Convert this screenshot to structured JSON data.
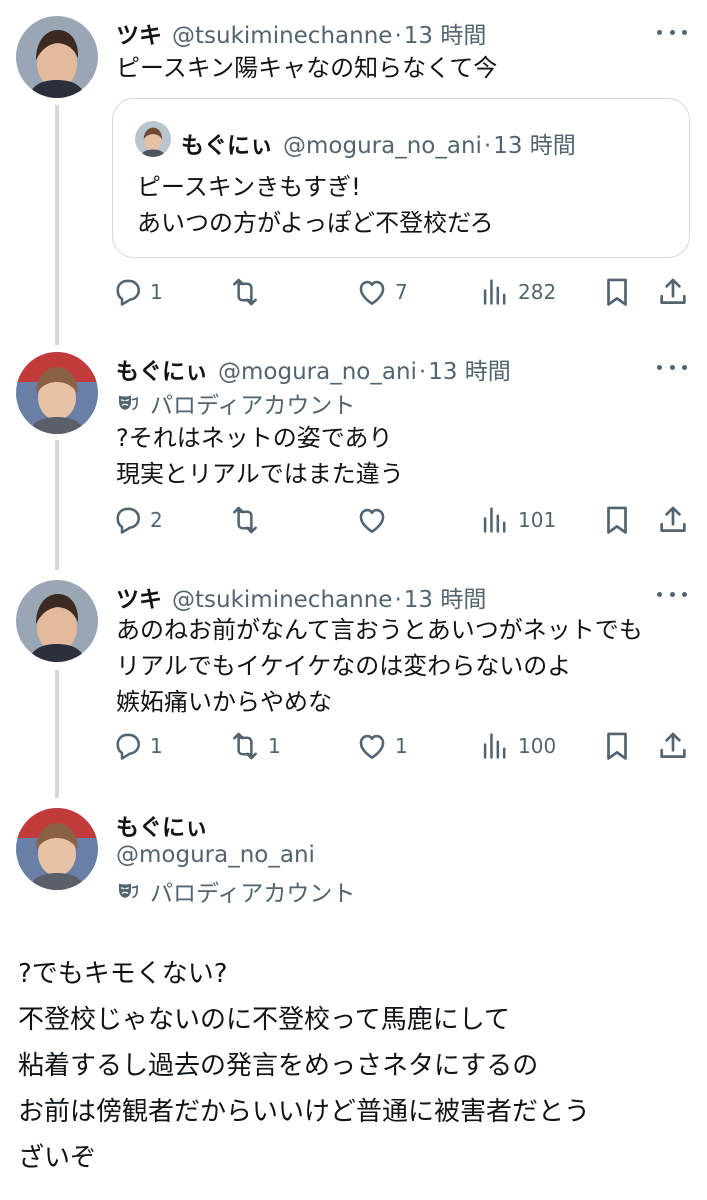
{
  "tweets": [
    {
      "name": "ツキ",
      "handle": "@tsukiminechanne",
      "time": "13 時間",
      "text": "ピースキン陽キャなの知らなくて今",
      "quote": {
        "name": "もぐにぃ",
        "handle": "@mogura_no_ani",
        "time": "13 時間",
        "text": "ピースキンきもすぎ!\nあいつの方がよっぽど不登校だろ"
      },
      "replies": "1",
      "reposts": "",
      "likes": "7",
      "views": "282"
    },
    {
      "name": "もぐにぃ",
      "handle": "@mogura_no_ani",
      "time": "13 時間",
      "label": "パロディアカウント",
      "text": "?それはネットの姿であり\n現実とリアルではまた違う",
      "replies": "2",
      "reposts": "",
      "likes": "",
      "views": "101"
    },
    {
      "name": "ツキ",
      "handle": "@tsukiminechanne",
      "time": "13 時間",
      "text": "あのねお前がなんて言おうとあいつがネットでも\nリアルでもイケイケなのは変わらないのよ\n嫉妬痛いからやめな",
      "replies": "1",
      "reposts": "1",
      "likes": "1",
      "views": "100"
    }
  ],
  "main": {
    "name": "もぐにぃ",
    "handle": "@mogura_no_ani",
    "label": "パロディアカウント",
    "text": "?でもキモくない?\n不登校じゃないのに不登校って馬鹿にして\n粘着するし過去の発言をめっさネタにするの\nお前は傍観者だからいいけど普通に被害者だとう\nざいぞ"
  },
  "colors": {
    "text": "#0f1419",
    "secondary": "#536471",
    "border": "#cfd9de"
  },
  "icons": [
    "reply-icon",
    "repost-icon",
    "like-icon",
    "views-icon",
    "bookmark-icon",
    "share-icon",
    "parody-mask-icon",
    "more-icon"
  ]
}
